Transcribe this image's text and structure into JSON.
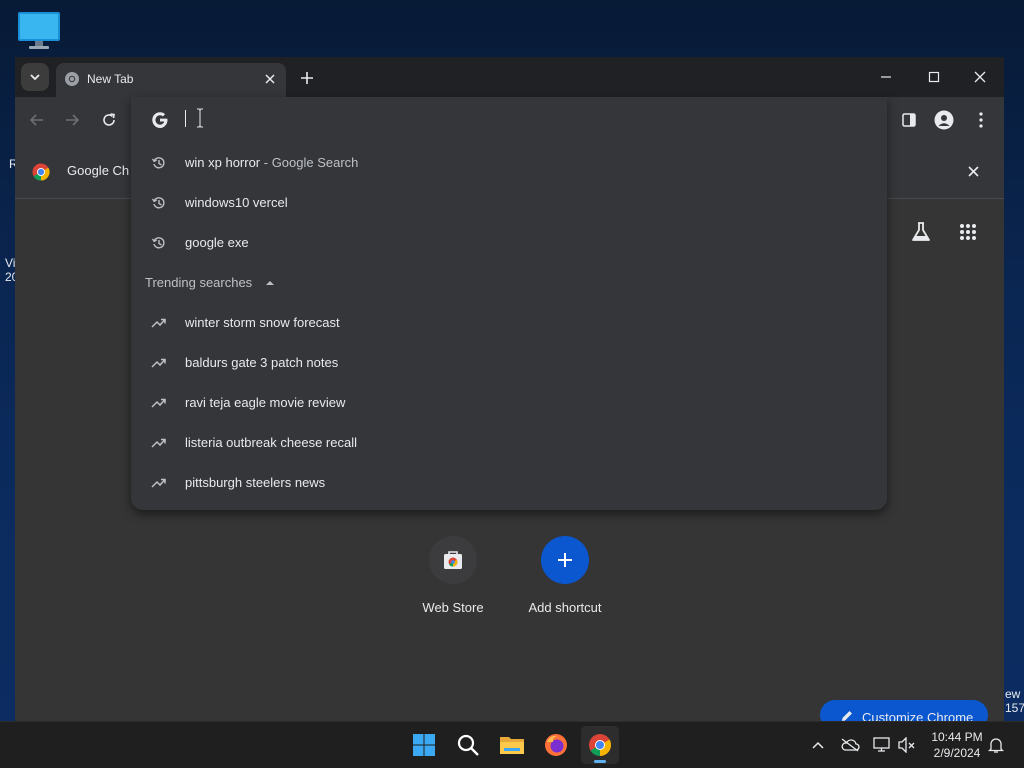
{
  "desktop": {
    "left_fragments": [
      "R",
      "Vi",
      "20"
    ],
    "right_fragments": [
      "ew",
      "157"
    ]
  },
  "browser": {
    "tab": {
      "title": "New Tab"
    },
    "bookmark_bar": {
      "item_label": "Google Ch"
    },
    "omnibox": {
      "value": "",
      "history": [
        {
          "text": "win xp horror",
          "suffix": " - Google Search"
        },
        {
          "text": "windows10 vercel",
          "suffix": ""
        },
        {
          "text": "google exe",
          "suffix": ""
        }
      ],
      "trending_header": "Trending searches",
      "trending": [
        "winter storm snow forecast",
        "baldurs gate 3 patch notes",
        "ravi teja eagle movie review",
        "listeria outbreak cheese recall",
        "pittsburgh steelers news"
      ]
    },
    "ntp": {
      "shortcuts": [
        {
          "label": "Web Store"
        },
        {
          "label": "Add shortcut"
        }
      ],
      "customize_label": "Customize Chrome"
    }
  },
  "taskbar": {
    "time": "10:44 PM",
    "date": "2/9/2024"
  },
  "colors": {
    "frame": "#202124",
    "toolbar": "#35363a",
    "accent": "#0b57d0",
    "add_shortcut": "#0b57d0"
  }
}
